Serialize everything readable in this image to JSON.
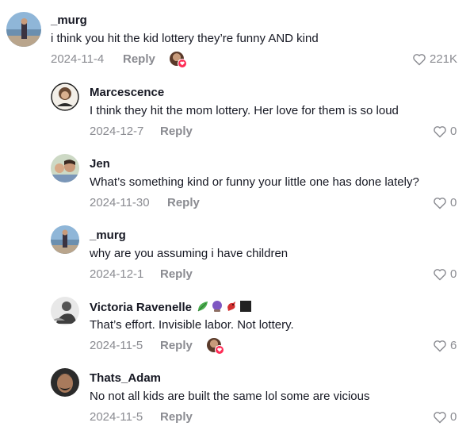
{
  "comments": [
    {
      "username": "_murg",
      "text": "i think you hit the kid lottery they’re funny AND kind",
      "date": "2024-11-4",
      "reply_label": "Reply",
      "likes": "221K",
      "creator_liked": true
    },
    {
      "username": "Marcescence",
      "text": "I think they hit the mom lottery. Her love for them is so loud",
      "date": "2024-12-7",
      "reply_label": "Reply",
      "likes": "0"
    },
    {
      "username": "Jen",
      "text": "What’s something kind or funny your little one has done lately?",
      "date": "2024-11-30",
      "reply_label": "Reply",
      "likes": "0"
    },
    {
      "username": "_murg",
      "text": "why are you assuming i have children",
      "date": "2024-12-1",
      "reply_label": "Reply",
      "likes": "0"
    },
    {
      "username": "Victoria Ravenelle",
      "username_emojis": [
        "leaf-emoji",
        "purple-orb-emoji",
        "cardinal-bird-emoji",
        "black-square-emoji"
      ],
      "text": "That’s effort. Invisible labor. Not lottery.",
      "date": "2024-11-5",
      "reply_label": "Reply",
      "likes": "6",
      "creator_liked": true
    },
    {
      "username": "Thats_Adam",
      "text": "No not all kids are built the same lol some are vicious",
      "date": "2024-11-5",
      "reply_label": "Reply",
      "likes": "0"
    }
  ],
  "icons": {
    "like": "heart-outline-icon",
    "creator_badge": "heart-badge-icon"
  },
  "colors": {
    "text": "#161823",
    "muted": "#8a8b91",
    "badge": "#fe2c55"
  }
}
